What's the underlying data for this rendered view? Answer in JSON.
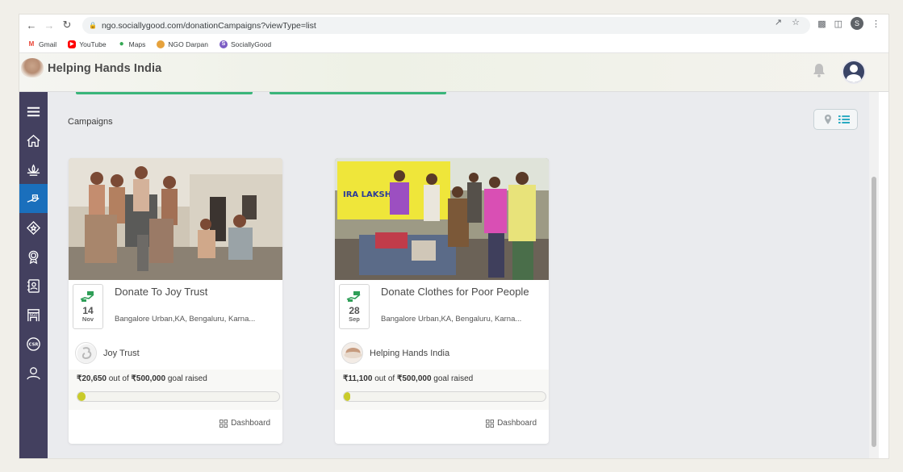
{
  "browser": {
    "url": "ngo.sociallygood.com/donationCampaigns?viewType=list",
    "profile_initial": "S",
    "bookmarks": [
      {
        "label": "Gmail",
        "icon": "gmail-icon",
        "color": "#ea4335"
      },
      {
        "label": "YouTube",
        "icon": "youtube-icon",
        "color": "#ff0000"
      },
      {
        "label": "Maps",
        "icon": "maps-icon",
        "color": "#34a853"
      },
      {
        "label": "NGO Darpan",
        "icon": "ngo-darpan-icon",
        "color": "#e6a23c"
      },
      {
        "label": "SociallyGood",
        "icon": "sociallygood-icon",
        "color": "#7b5cc4"
      }
    ]
  },
  "header": {
    "title": "Helping Hands India"
  },
  "sidebar": {
    "items": [
      {
        "name": "menu-icon",
        "active": false
      },
      {
        "name": "home-icon",
        "active": false
      },
      {
        "name": "lotus-icon",
        "active": false
      },
      {
        "name": "donation-hand-icon",
        "active": true
      },
      {
        "name": "volunteer-badge-icon",
        "active": false
      },
      {
        "name": "award-icon",
        "active": false
      },
      {
        "name": "contacts-icon",
        "active": false
      },
      {
        "name": "ngo-icon",
        "active": false
      },
      {
        "name": "csr-icon",
        "active": false
      },
      {
        "name": "users-icon",
        "active": false
      }
    ]
  },
  "main": {
    "section_title": "Campaigns"
  },
  "campaigns": [
    {
      "title": "Donate To Joy Trust",
      "day": "14",
      "month": "Nov",
      "location": "Bangalore Urban,KA, Bengaluru, Karna...",
      "org_name": "Joy Trust",
      "raised": "₹20,650",
      "out_of": "out of",
      "goal": "₹500,000",
      "goal_suffix": "goal raised",
      "progress_fraction": 0.041,
      "dashboard_label": "Dashboard"
    },
    {
      "title": "Donate Clothes for Poor People",
      "day": "28",
      "month": "Sep",
      "location": "Bangalore Urban,KA, Bengaluru, Karna...",
      "org_name": "Helping Hands India",
      "raised": "₹11,100",
      "out_of": "out of",
      "goal": "₹500,000",
      "goal_suffix": "goal raised",
      "progress_fraction": 0.022,
      "dashboard_label": "Dashboard"
    }
  ],
  "colors": {
    "sidebar_bg": "#43405f",
    "sidebar_active": "#1a6fbc",
    "accent_green": "#3ab57a",
    "progress_fill": "#c9cb2a"
  }
}
